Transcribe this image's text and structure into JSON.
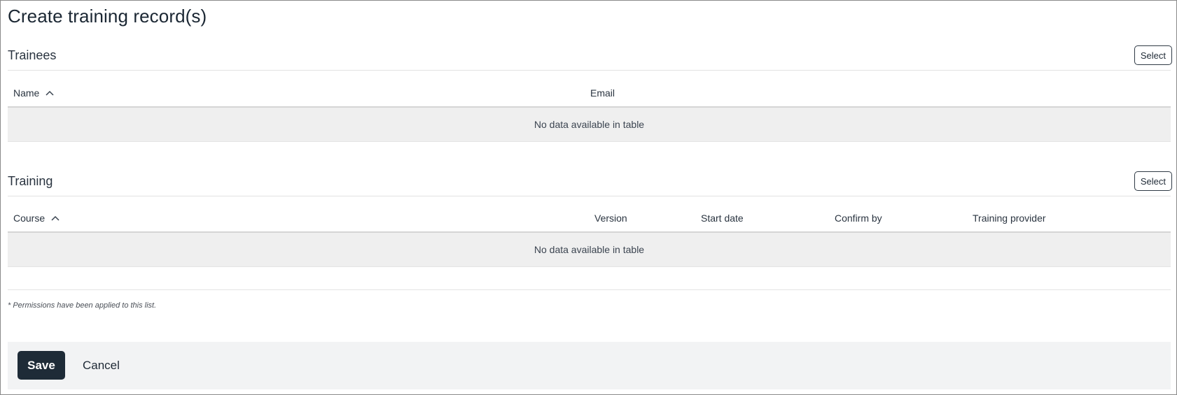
{
  "page": {
    "title": "Create training record(s)"
  },
  "trainees": {
    "title": "Trainees",
    "select_label": "Select",
    "columns": [
      {
        "label": "Name",
        "sorted": "asc"
      },
      {
        "label": "Email"
      }
    ],
    "empty_message": "No data available in table"
  },
  "training": {
    "title": "Training",
    "select_label": "Select",
    "columns": [
      {
        "label": "Course",
        "sorted": "asc"
      },
      {
        "label": "Version"
      },
      {
        "label": "Start date"
      },
      {
        "label": "Confirm by"
      },
      {
        "label": "Training provider"
      }
    ],
    "empty_message": "No data available in table"
  },
  "note": "* Permissions have been applied to this list.",
  "footer": {
    "save_label": "Save",
    "cancel_label": "Cancel"
  },
  "icons": {
    "sort": "chevron-up-icon"
  },
  "colors": {
    "primary_button": "#1e2b37",
    "empty_row_bg": "#efefef",
    "footer_bg": "#f2f3f4"
  }
}
